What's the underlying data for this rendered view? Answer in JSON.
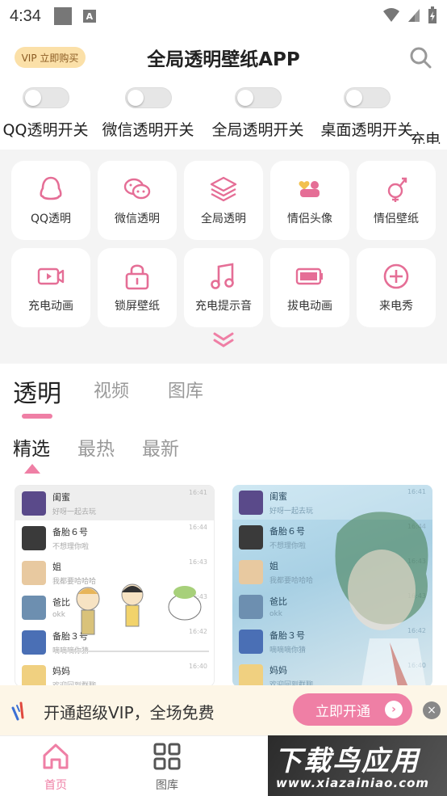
{
  "status_bar": {
    "time": "4:34"
  },
  "header": {
    "vip_label": "VIP 立即购买",
    "title": "全局透明壁纸APP"
  },
  "toggles": [
    {
      "label": "QQ透明开关",
      "on": false
    },
    {
      "label": "微信透明开关",
      "on": false
    },
    {
      "label": "全局透明开关",
      "on": false
    },
    {
      "label": "桌面透明开关",
      "on": false
    },
    {
      "label": "充电",
      "on": false
    }
  ],
  "features": [
    {
      "label": "QQ透明",
      "icon": "qq-penguin-icon"
    },
    {
      "label": "微信透明",
      "icon": "wechat-icon"
    },
    {
      "label": "全局透明",
      "icon": "layers-icon"
    },
    {
      "label": "情侣头像",
      "icon": "couple-avatar-icon"
    },
    {
      "label": "情侣壁纸",
      "icon": "couple-wallpaper-icon"
    },
    {
      "label": "充电动画",
      "icon": "video-icon"
    },
    {
      "label": "锁屏壁纸",
      "icon": "lock-icon"
    },
    {
      "label": "充电提示音",
      "icon": "music-note-icon"
    },
    {
      "label": "拔电动画",
      "icon": "battery-icon"
    },
    {
      "label": "来电秀",
      "icon": "plus-circle-icon"
    }
  ],
  "main_tabs": [
    "透明",
    "视频",
    "图库"
  ],
  "sub_tabs": [
    "精选",
    "最热",
    "最新"
  ],
  "chat_list": [
    {
      "name": "闺蜜",
      "msg": "好呀一起去玩",
      "time": "16:41",
      "avatar_color": "#5a4a8a"
    },
    {
      "name": "备胎６号",
      "msg": "不想理你啦",
      "time": "16:44",
      "avatar_color": "#3a3a3a"
    },
    {
      "name": "姐",
      "msg": "我都要哈哈哈",
      "time": "16:43",
      "avatar_color": "#e8c9a0"
    },
    {
      "name": "爸比",
      "msg": "okk",
      "time": "16:43",
      "avatar_color": "#6d8fb0"
    },
    {
      "name": "备胎３号",
      "msg": "嘀嘀嘀你猜",
      "time": "16:42",
      "avatar_color": "#4a6fb5"
    },
    {
      "name": "妈妈",
      "msg": "欢迎回到群聊",
      "time": "16:40",
      "avatar_color": "#f0d080"
    }
  ],
  "vip_banner": {
    "text": "开通超级VIP，全场免费",
    "button": "立即开通"
  },
  "bottom_nav": [
    {
      "label": "首页",
      "active": true
    },
    {
      "label": "图库",
      "active": false
    }
  ],
  "watermark": {
    "main": "下载鸟应用",
    "sub": "www.xiazainiao.com"
  },
  "colors": {
    "accent": "#ef7fa5",
    "vip_gold": "#fbe0a8"
  }
}
